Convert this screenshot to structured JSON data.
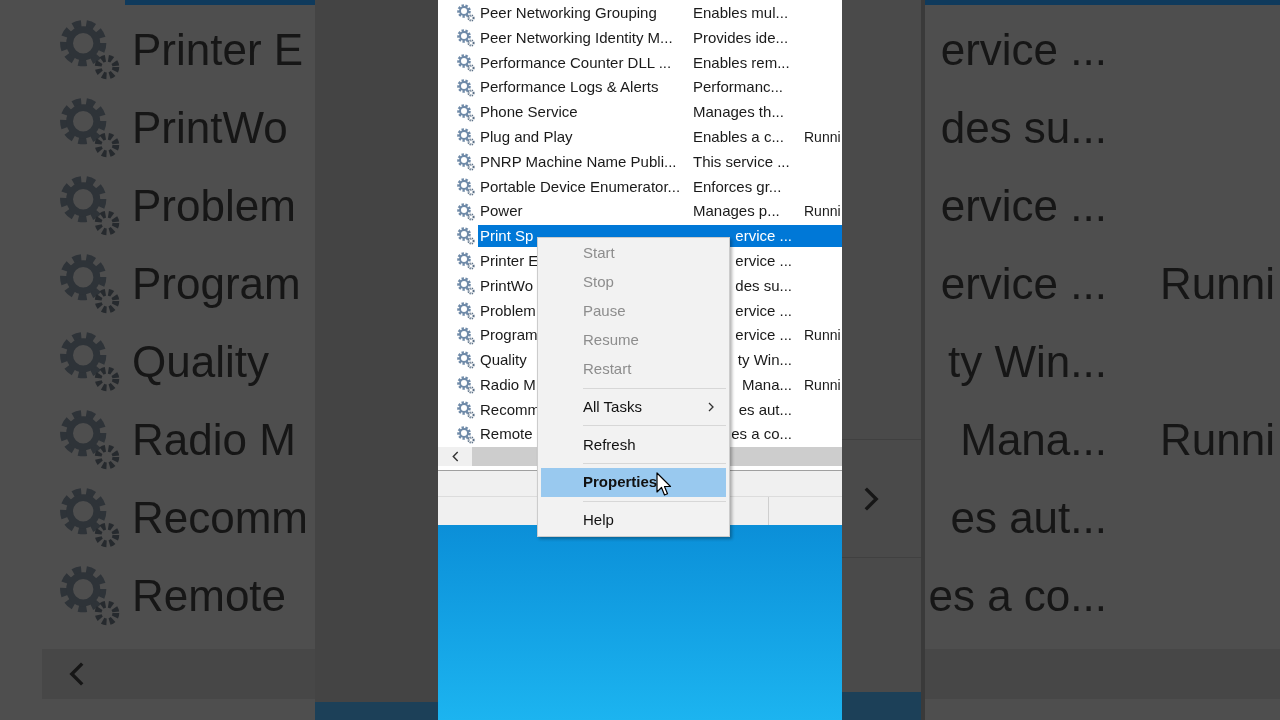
{
  "backdrop_left": {
    "rows": [
      "Printer E",
      "PrintWo",
      "Problem",
      "Program",
      "Quality",
      "Radio M",
      "Recomm",
      "Remote"
    ]
  },
  "services": {
    "rows": [
      {
        "name": "Peer Networking Grouping",
        "description": "Enables mul...",
        "selected": false,
        "under_menu": false
      },
      {
        "name": "Peer Networking Identity M...",
        "description": "Provides ide...",
        "selected": false,
        "under_menu": false
      },
      {
        "name": "Performance Counter DLL ...",
        "description": "Enables rem...",
        "selected": false,
        "under_menu": false
      },
      {
        "name": "Performance Logs & Alerts",
        "description": "Performanc...",
        "selected": false,
        "under_menu": false
      },
      {
        "name": "Phone Service",
        "description": "Manages th...",
        "selected": false,
        "under_menu": false
      },
      {
        "name": "Plug and Play",
        "description": "Enables a c...",
        "status": "Runni",
        "selected": false,
        "under_menu": false
      },
      {
        "name": "PNRP Machine Name Publi...",
        "description": "This service ...",
        "selected": false,
        "under_menu": false
      },
      {
        "name": "Portable Device Enumerator...",
        "description": "Enforces gr...",
        "selected": false,
        "under_menu": false
      },
      {
        "name": "Power",
        "description": "Manages p...",
        "status": "Runni",
        "selected": false,
        "under_menu": false
      },
      {
        "name": "Print Sp",
        "description": "ervice ...",
        "selected": true,
        "under_menu": true
      },
      {
        "name": "Printer E",
        "description": "ervice ...",
        "selected": false,
        "under_menu": true
      },
      {
        "name": "PrintWo",
        "description": "des su...",
        "selected": false,
        "under_menu": true
      },
      {
        "name": "Problem",
        "description": "ervice ...",
        "selected": false,
        "under_menu": true
      },
      {
        "name": "Program",
        "description": "ervice ...",
        "status": "Runni",
        "selected": false,
        "under_menu": true
      },
      {
        "name": "Quality",
        "description": "ty Win...",
        "selected": false,
        "under_menu": true
      },
      {
        "name": "Radio M",
        "description": "Mana...",
        "status": "Runni",
        "selected": false,
        "under_menu": true
      },
      {
        "name": "Recomm",
        "description": "es aut...",
        "selected": false,
        "under_menu": true
      },
      {
        "name": "Remote",
        "description": "es a co...",
        "selected": false,
        "under_menu": true
      }
    ]
  },
  "context_menu": {
    "items": [
      {
        "kind": "item",
        "label": "Start",
        "disabled": true,
        "bold": false,
        "selected": false
      },
      {
        "kind": "item",
        "label": "Stop",
        "disabled": true,
        "bold": false,
        "selected": false
      },
      {
        "kind": "item",
        "label": "Pause",
        "disabled": true,
        "bold": false,
        "selected": false
      },
      {
        "kind": "item",
        "label": "Resume",
        "disabled": true,
        "bold": false,
        "selected": false
      },
      {
        "kind": "item",
        "label": "Restart",
        "disabled": true,
        "bold": false,
        "selected": false
      },
      {
        "kind": "separator"
      },
      {
        "kind": "submenu",
        "label": "All Tasks",
        "disabled": false,
        "bold": false,
        "selected": false
      },
      {
        "kind": "separator"
      },
      {
        "kind": "item",
        "label": "Refresh",
        "disabled": false,
        "bold": false,
        "selected": false
      },
      {
        "kind": "separator"
      },
      {
        "kind": "item",
        "label": "Properties",
        "disabled": false,
        "bold": true,
        "selected": true
      },
      {
        "kind": "separator"
      },
      {
        "kind": "item",
        "label": "Help",
        "disabled": false,
        "bold": false,
        "selected": false
      }
    ]
  },
  "backdrop_right": {
    "rows": [
      {
        "description": "ervice ..."
      },
      {
        "description": "des su..."
      },
      {
        "description": "ervice ..."
      },
      {
        "description": "ervice ...",
        "status": "Runni"
      },
      {
        "description": "ty Win..."
      },
      {
        "description": "Mana...",
        "status": "Runni"
      },
      {
        "description": "es aut..."
      },
      {
        "description": "es a co..."
      }
    ]
  }
}
